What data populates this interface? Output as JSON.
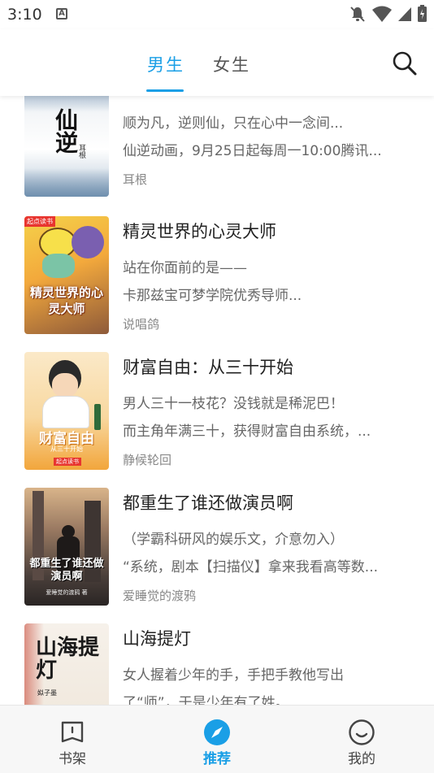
{
  "status_bar": {
    "time": "3:10",
    "badge": "A"
  },
  "header": {
    "tabs": [
      {
        "label": "男生",
        "active": true
      },
      {
        "label": "女生",
        "active": false
      }
    ]
  },
  "books": [
    {
      "title": "仙逆",
      "desc": [
        "顺为凡，逆则仙，只在心中一念间...",
        "仙逆动画，9月25日起每周一10:00腾讯..."
      ],
      "author": "耳根",
      "cover_text": "仙逆",
      "cover_sub": "耳根"
    },
    {
      "title": "精灵世界的心灵大师",
      "desc": [
        "站在你面前的是——",
        "卡那兹宝可梦学院优秀导师..."
      ],
      "author": "说唱鸽",
      "cover_text": "精灵世界的心灵大师",
      "cover_badge": "起点读书"
    },
    {
      "title": "财富自由：从三十开始",
      "desc": [
        "男人三十一枝花？没钱就是稀泥巴！",
        "而主角年满三十，获得财富自由系统，..."
      ],
      "author": "静候轮回",
      "cover_text": "财富自由",
      "cover_sub": "从三十开始",
      "cover_badge": "起点读书"
    },
    {
      "title": "都重生了谁还做演员啊",
      "desc": [
        "（学霸科研风的娱乐文，介意勿入）",
        "“系统，剧本【扫描仪】拿来我看高等数..."
      ],
      "author": "爱睡觉的渡鸦",
      "cover_text": "都重生了谁还做演员啊",
      "cover_sub": "爱睡觉的渡鸦 著"
    },
    {
      "title": "山海提灯",
      "desc": [
        "女人握着少年的手，手把手教他写出",
        "了“师”，于是少年有了姓。 ..."
      ],
      "author": "",
      "cover_text": "山海提灯",
      "cover_sub": "姒子墨"
    }
  ],
  "bottom_nav": [
    {
      "label": "书架",
      "icon": "bookshelf-icon",
      "active": false
    },
    {
      "label": "推荐",
      "icon": "compass-icon",
      "active": true
    },
    {
      "label": "我的",
      "icon": "smiley-icon",
      "active": false
    }
  ],
  "colors": {
    "accent": "#1a9fe6",
    "text": "#222222",
    "muted": "#666666"
  }
}
